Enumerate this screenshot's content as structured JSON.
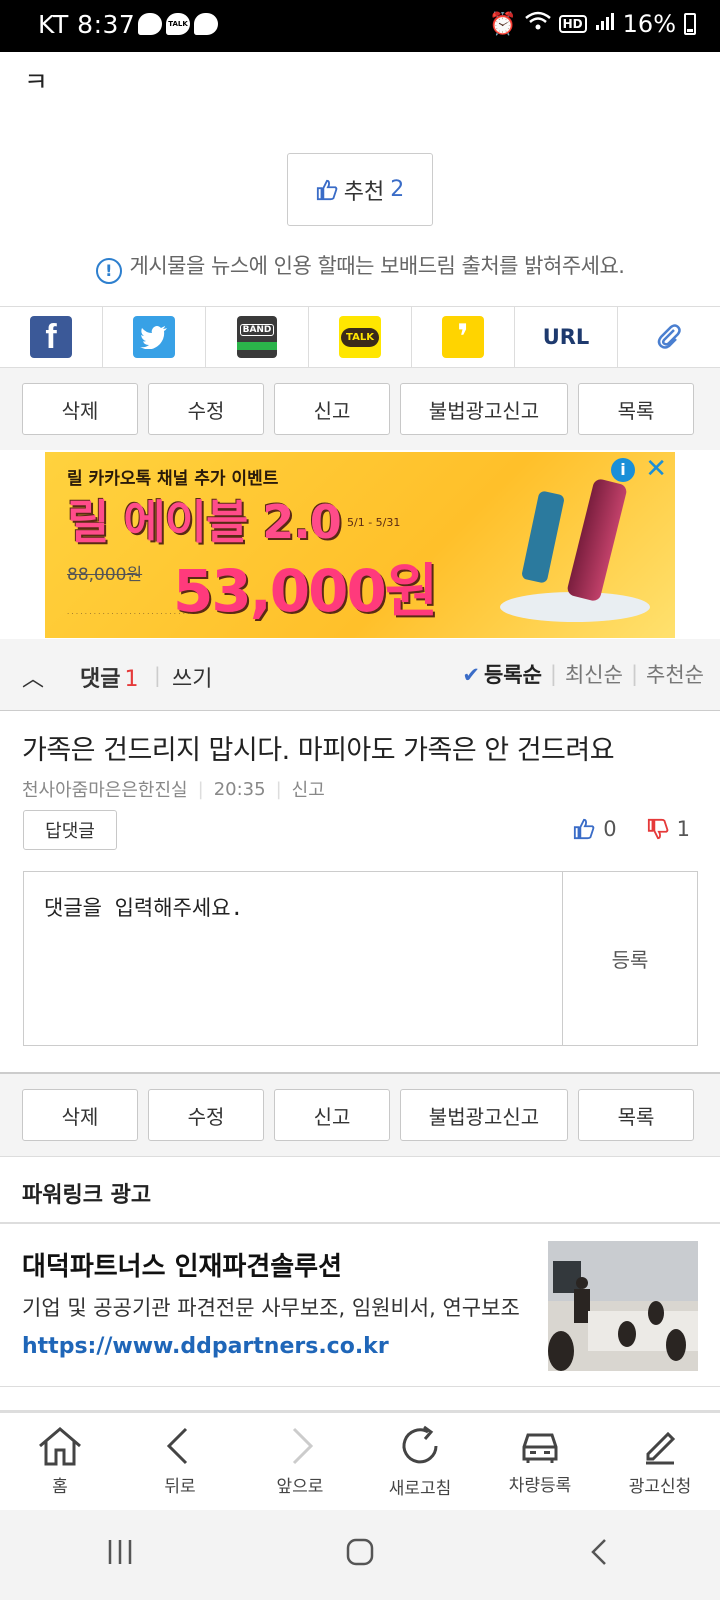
{
  "status": {
    "carrier_time": "KT 8:37",
    "battery": "16%",
    "notifications": [
      "",
      "TALK",
      ""
    ]
  },
  "post": {
    "tail_char": "ㅋ",
    "recommend_label": "추천",
    "recommend_count": "2",
    "notice": "게시물을 뉴스에 인용 할때는 보배드림 출처를 밝혀주세요."
  },
  "share": {
    "band": "BAND",
    "talk": "TALK",
    "url": "URL"
  },
  "actions_top": [
    "삭제",
    "수정",
    "신고",
    "불법광고신고",
    "목록"
  ],
  "ad": {
    "top": "릴 카카오톡 채널 추가 이벤트",
    "title": "릴 에이블 2.0",
    "date": "5/1 - 5/31",
    "old_price": "88,000원",
    "price": "53,000원"
  },
  "comments": {
    "label": "댓글",
    "count": "1",
    "write": "쓰기",
    "sort": [
      "등록순",
      "최신순",
      "추천순"
    ],
    "items": [
      {
        "text": "가족은 건드리지 맙시다. 마피아도 가족은 안 건드려요",
        "author": "천사아줌마은은한진실",
        "time": "20:35",
        "report": "신고",
        "reply": "답댓글",
        "up": "0",
        "down": "1"
      }
    ],
    "input_placeholder": "댓글을 입력해주세요.",
    "submit": "등록"
  },
  "actions_bottom": [
    "삭제",
    "수정",
    "신고",
    "불법광고신고",
    "목록"
  ],
  "powerlink": {
    "header": "파워링크 광고",
    "title": "대덕파트너스 인재파견솔루션",
    "desc": "기업 및 공공기관 파견전문 사무보조, 임원비서, 연구보조",
    "url": "https://www.ddpartners.co.kr"
  },
  "bottom_nav": [
    "홈",
    "뒤로",
    "앞으로",
    "새로고침",
    "차량등록",
    "광고신청"
  ]
}
